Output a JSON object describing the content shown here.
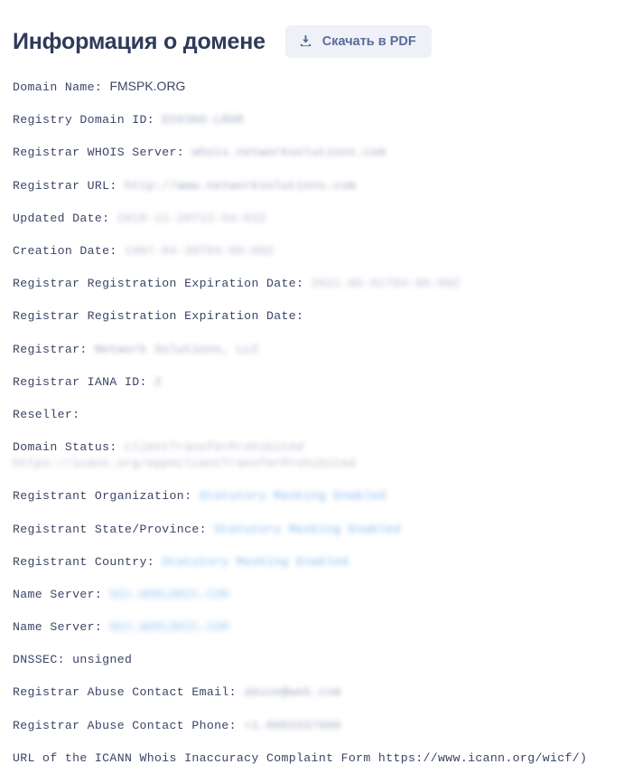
{
  "header": {
    "title": "Информация о домене",
    "pdf_button_label": "Скачать в PDF",
    "pdf_button_icon": "download-icon",
    "accent_color": "#2e3a59",
    "button_bg": "#eef1f7",
    "button_text_color": "#5a6c98"
  },
  "whois": {
    "text_color": "#3b4566",
    "lines": [
      {
        "label": "Domain Name: ",
        "value": "FMSPK.ORG",
        "style": "plain"
      },
      {
        "label": "Registry Domain ID: ",
        "value": "D29366-LROR",
        "style": "blur-gray"
      },
      {
        "label": "Registrar WHOIS Server: ",
        "value": "whois.networksolutions.com",
        "style": "blur-gray"
      },
      {
        "label": "Registrar URL: ",
        "value": "http://www.networksolutions.com",
        "style": "blur-gray"
      },
      {
        "label": "Updated Date: ",
        "value": "2018-11-20T13:54:03Z",
        "style": "blur-faint"
      },
      {
        "label": "Creation Date: ",
        "value": "1997-04-30T04:00:00Z",
        "style": "blur-faint"
      },
      {
        "label": "Registrar Registration Expiration Date: ",
        "value": "2021-05-01T04:00:00Z",
        "style": "blur-faint"
      },
      {
        "label": "Registrar Registration Expiration Date: ",
        "value": "",
        "style": "none"
      },
      {
        "label": "Registrar: ",
        "value": "Network Solutions, LLC",
        "style": "blur-gray"
      },
      {
        "label": "Registrar IANA ID: ",
        "value": "2",
        "style": "blur-gray"
      },
      {
        "label": "Reseller: ",
        "value": "",
        "style": "none"
      },
      {
        "label": "Domain Status: ",
        "value": "clientTransferProhibited https://icann.org/epp#clientTransferProhibited",
        "style": "blur-faint"
      },
      {
        "label": "Registrant Organization: ",
        "value": "Statutory Masking Enabled",
        "style": "blur-blue"
      },
      {
        "label": "Registrant State/Province: ",
        "value": "Statutory Masking Enabled",
        "style": "blur-blue"
      },
      {
        "label": "Registrant Country: ",
        "value": "Statutory Masking Enabled",
        "style": "blur-blue"
      },
      {
        "label": "Name Server: ",
        "value": "NS1.WORLDNIC.COM",
        "style": "blur-strong"
      },
      {
        "label": "Name Server: ",
        "value": "NS2.WORLDNIC.COM",
        "style": "blur-strong"
      },
      {
        "label": "DNSSEC: ",
        "value": "unsigned",
        "style": "mono"
      },
      {
        "label": "Registrar Abuse Contact Email: ",
        "value": "abuse@web.com",
        "style": "blur-gray"
      },
      {
        "label": "Registrar Abuse Contact Phone: ",
        "value": "+1.8003337680",
        "style": "blur-gray"
      },
      {
        "label": "URL of the ICANN Whois Inaccuracy Complaint Form https://www.icann.org/wicf/)",
        "value": "",
        "style": "none"
      }
    ]
  }
}
